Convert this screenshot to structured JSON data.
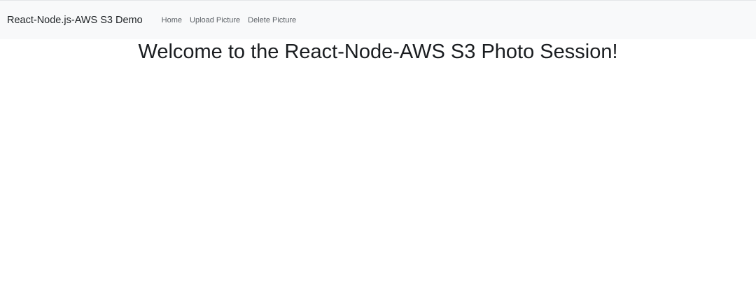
{
  "navbar": {
    "brand": "React-Node.js-AWS S3 Demo",
    "links": [
      {
        "label": "Home"
      },
      {
        "label": "Upload Picture"
      },
      {
        "label": "Delete Picture"
      }
    ]
  },
  "main": {
    "title": "Welcome to the React-Node-AWS S3 Photo Session!"
  },
  "colors": {
    "navbar_background": "#f8f9fa",
    "page_background": "#ffffff",
    "text": "#212529",
    "nav_link": "#5c6166"
  }
}
